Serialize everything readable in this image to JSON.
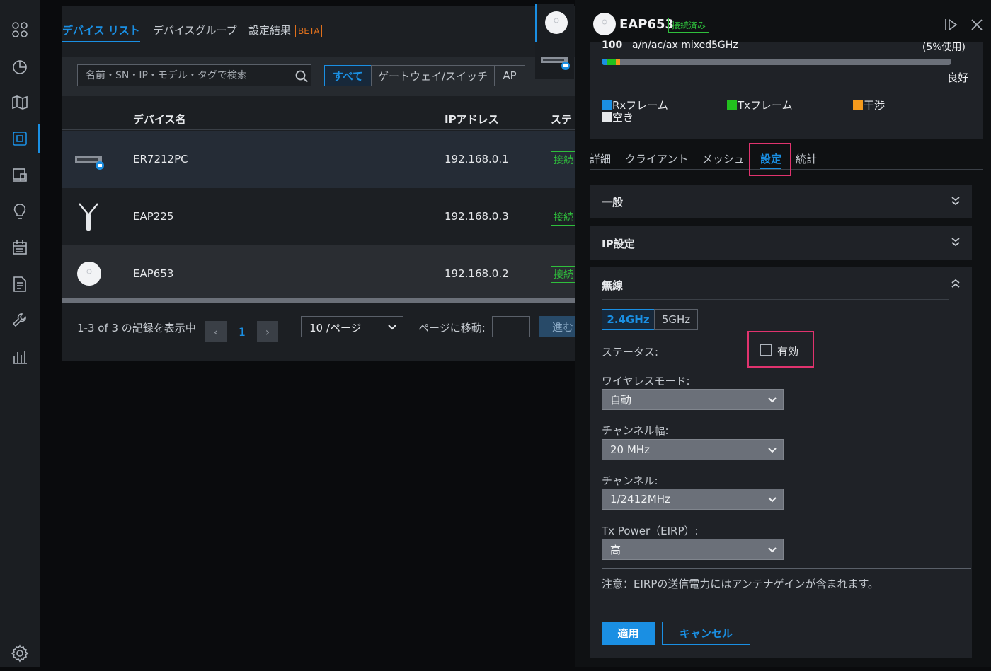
{
  "sidebar": {
    "items": [
      "dashboard",
      "statistics",
      "map",
      "devices",
      "insights",
      "logs",
      "alerts",
      "reports",
      "tools",
      "analytics",
      "settings"
    ]
  },
  "tabs": {
    "device_list": "デバイス リスト",
    "device_group": "デバイスグループ",
    "config_result": "設定結果",
    "beta": "BETA"
  },
  "search": {
    "placeholder": "名前・SN・IP・モデル・タグで検索"
  },
  "filters": {
    "all": "すべて",
    "gateway_switch": "ゲートウェイ/スイッチ",
    "ap": "AP"
  },
  "table": {
    "headers": {
      "name": "デバイス名",
      "ip": "IPアドレス",
      "status": "ステ"
    },
    "rows": [
      {
        "name": "ER7212PC",
        "ip": "192.168.0.1",
        "status": "接続"
      },
      {
        "name": "EAP225",
        "ip": "192.168.0.3",
        "status": "接続"
      },
      {
        "name": "EAP653",
        "ip": "192.168.0.2",
        "status": "接続"
      }
    ]
  },
  "pagination": {
    "summary": "1-3 of 3 の記録を表示中",
    "page": "1",
    "per_page": "10 /ページ",
    "goto": "ページに移動:",
    "go": "進む"
  },
  "panel": {
    "device": "EAP653",
    "connected": "接続済み",
    "channel_util": {
      "num": "100",
      "mode": "a/n/ac/ax mixed",
      "band": "5GHz",
      "usage": "(5%使用)",
      "quality": "良好"
    },
    "legend": {
      "rx": "Rxフレーム",
      "tx": "Txフレーム",
      "interference": "干渉",
      "free": "空き"
    },
    "tabs": {
      "details": "詳細",
      "clients": "クライアント",
      "mesh": "メッシュ",
      "settings": "設定",
      "stats": "統計"
    },
    "sections": {
      "general": "一般",
      "ip": "IP設定",
      "wireless": "無線"
    },
    "bands": {
      "b24": "2.4GHz",
      "b5": "5GHz"
    },
    "status_label": "ステータス:",
    "enable": "有効",
    "wireless_mode_label": "ワイヤレスモード:",
    "wireless_mode": "自動",
    "channel_width_label": "チャンネル幅:",
    "channel_width": "20 MHz",
    "channel_label": "チャンネル:",
    "channel": "1/2412MHz",
    "tx_power_label": "Tx Power（EIRP）:",
    "tx_power": "高",
    "note": "注意：EIRPの送信電力にはアンテナゲインが含まれます。",
    "apply": "適用",
    "cancel": "キャンセル"
  },
  "colors": {
    "accent": "#1a8fe3",
    "ok": "#2fbf3c",
    "highlight": "#e0336e",
    "rx": "#1a8fe3",
    "tx": "#22c01e",
    "interference": "#f59a1c",
    "free": "#e6e8eb"
  }
}
